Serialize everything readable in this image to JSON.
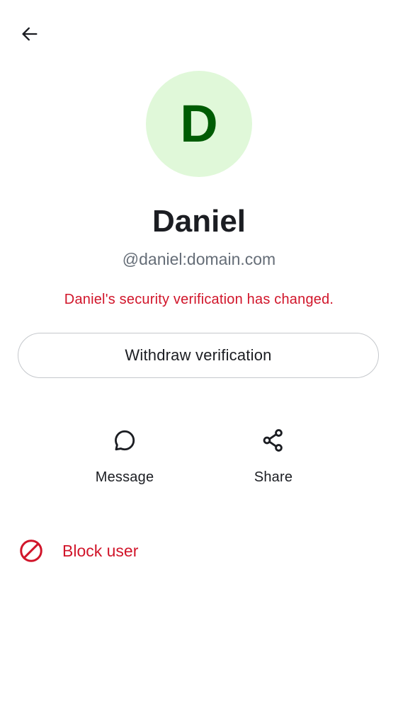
{
  "header": {
    "back_icon": "arrow-left-icon"
  },
  "profile": {
    "avatar_initial": "D",
    "avatar_bg_color": "#e0f8d9",
    "avatar_text_color": "#005c04",
    "display_name": "Daniel",
    "user_id": "@daniel:domain.com",
    "verification_warning": "Daniel's security verification has changed.",
    "warning_color": "#d1152a"
  },
  "withdraw_button": {
    "label": "Withdraw verification"
  },
  "actions": [
    {
      "label": "Message",
      "icon": "chat-bubble-icon"
    },
    {
      "label": "Share",
      "icon": "share-icon"
    }
  ],
  "block": {
    "label": "Block user",
    "icon": "block-icon",
    "color": "#d1152a"
  }
}
